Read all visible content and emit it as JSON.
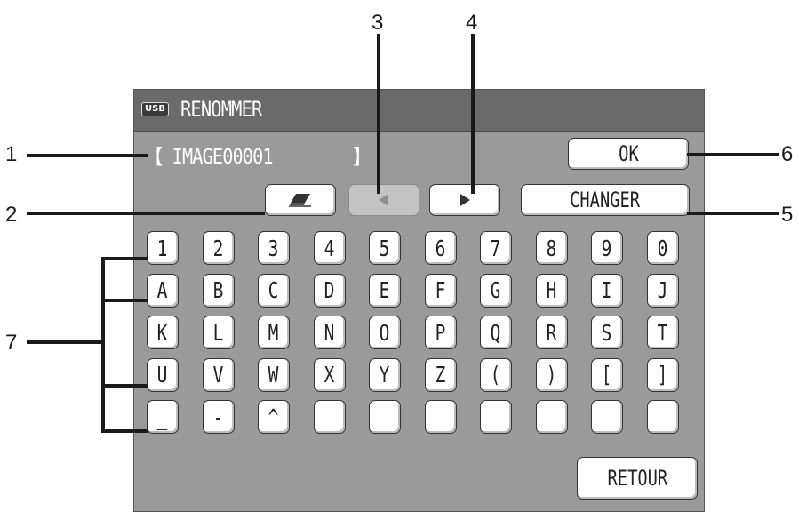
{
  "callouts": [
    "1",
    "2",
    "3",
    "4",
    "5",
    "6",
    "7"
  ],
  "header": {
    "usb_badge": "USB",
    "title": "RENOMMER"
  },
  "filename": {
    "text": "【 IMAGE00001        】"
  },
  "toolbar": {
    "erase_icon": "eraser-icon",
    "left_icon": "arrow-left-icon",
    "right_icon": "arrow-right-icon",
    "change_label": "CHANGER",
    "ok_label": "OK"
  },
  "keyboard": {
    "rows": [
      [
        "1",
        "2",
        "3",
        "4",
        "5",
        "6",
        "7",
        "8",
        "9",
        "0"
      ],
      [
        "A",
        "B",
        "C",
        "D",
        "E",
        "F",
        "G",
        "H",
        "I",
        "J"
      ],
      [
        "K",
        "L",
        "M",
        "N",
        "O",
        "P",
        "Q",
        "R",
        "S",
        "T"
      ],
      [
        "U",
        "V",
        "W",
        "X",
        "Y",
        "Z",
        "(",
        ")",
        "[",
        "]"
      ],
      [
        "_",
        "-",
        "^",
        "",
        "",
        "",
        "",
        "",
        "",
        ""
      ]
    ]
  },
  "footer": {
    "back_label": "RETOUR"
  },
  "colors": {
    "screen_bg": "#9a9a9a",
    "titlebar_bg": "#6a6a6a",
    "key_bg": "#ffffff",
    "disabled_bg": "#c4c4c4"
  }
}
